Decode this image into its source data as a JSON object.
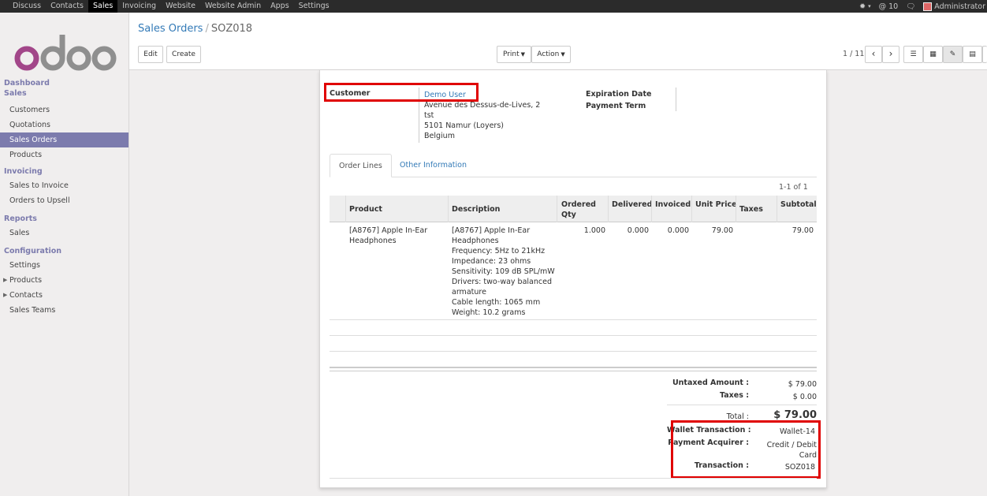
{
  "topbar": {
    "menu": [
      "Discuss",
      "Contacts",
      "Sales",
      "Invoicing",
      "Website",
      "Website Admin",
      "Apps",
      "Settings"
    ],
    "active": "Sales",
    "mentions_count": "10",
    "user": "Administrator"
  },
  "sidebar": {
    "logo_text": "odoo",
    "dashboard": "Dashboard",
    "sales_head": "Sales",
    "sales_items": [
      "Customers",
      "Quotations",
      "Sales Orders",
      "Products"
    ],
    "invoicing_head": "Invoicing",
    "invoicing_items": [
      "Sales to Invoice",
      "Orders to Upsell"
    ],
    "reports_head": "Reports",
    "reports_items": [
      "Sales"
    ],
    "config_head": "Configuration",
    "config_items": [
      "Settings",
      "Products",
      "Contacts",
      "Sales Teams"
    ]
  },
  "control": {
    "breadcrumb_parent": "Sales Orders",
    "breadcrumb_current": "SOZ018",
    "edit": "Edit",
    "create": "Create",
    "print": "Print",
    "action": "Action",
    "pager": "1 / 11"
  },
  "form": {
    "customer_label": "Customer",
    "customer_name": "Demo User",
    "address": [
      "Avenue des Dessus-de-Lives, 2",
      "tst",
      "5101 Namur (Loyers)",
      "Belgium"
    ],
    "expiration_label": "Expiration Date",
    "payment_term_label": "Payment Term",
    "tabs": [
      "Order Lines",
      "Other Information"
    ],
    "records_count": "1-1 of 1",
    "columns": [
      "Product",
      "Description",
      "Ordered Qty",
      "Delivered",
      "Invoiced",
      "Unit Price",
      "Taxes",
      "Subtotal"
    ],
    "line": {
      "product": [
        "[A8767] Apple In-Ear",
        "Headphones"
      ],
      "description": [
        "[A8767] Apple In-Ear",
        "Headphones",
        "Frequency: 5Hz to 21kHz",
        "Impedance: 23 ohms",
        "Sensitivity: 109 dB SPL/mW",
        "Drivers: two-way balanced",
        "armature",
        "Cable length: 1065 mm",
        "Weight: 10.2 grams"
      ],
      "ordered_qty": "1.000",
      "delivered": "0.000",
      "invoiced": "0.000",
      "unit_price": "79.00",
      "taxes": "",
      "subtotal": "79.00"
    },
    "totals": {
      "untaxed_label": "Untaxed Amount :",
      "untaxed_value": "$ 79.00",
      "taxes_label": "Taxes :",
      "taxes_value": "$ 0.00",
      "total_label": "Total :",
      "total_value": "$ 79.00"
    },
    "payment": {
      "wallet_label": "Wallet Transaction :",
      "wallet_value": "Wallet-14",
      "acquirer_label": "Payment Acquirer :",
      "acquirer_value": [
        "Credit / Debit",
        "Card"
      ],
      "transaction_label": "Transaction :",
      "transaction_value": "SOZ018"
    }
  },
  "colors": {
    "topbar": "#2b2b2b",
    "accent": "#7c7bad",
    "link": "#337ab7",
    "highlight": "#e00000"
  }
}
